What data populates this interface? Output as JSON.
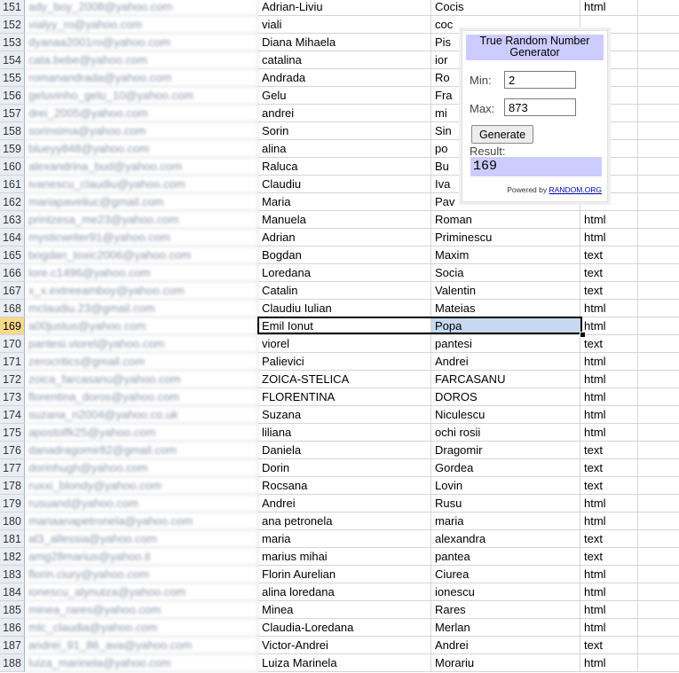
{
  "spreadsheet": {
    "active_row": "169",
    "rows": [
      {
        "num": "151",
        "email": "ady_boy_2008@yahoo.com",
        "first": "Adrian-Liviu",
        "last": "Cocis",
        "type": "html"
      },
      {
        "num": "152",
        "email": "vialyy_ro@yahoo.com",
        "first": "viali",
        "last": "coc",
        "type": ""
      },
      {
        "num": "153",
        "email": "dyanaa2001ro@yahoo.com",
        "first": "Diana Mihaela",
        "last": "Pis",
        "type": ""
      },
      {
        "num": "154",
        "email": "cata.bebe@yahoo.com",
        "first": "catalina",
        "last": "ior",
        "type": ""
      },
      {
        "num": "155",
        "email": "romanandrada@yahoo.com",
        "first": "Andrada",
        "last": "Ro",
        "type": ""
      },
      {
        "num": "156",
        "email": "geluvinho_gelu_10@yahoo.com",
        "first": "Gelu",
        "last": "Fra",
        "type": ""
      },
      {
        "num": "157",
        "email": "drei_2005@yahoo.com",
        "first": "andrei",
        "last": "mi",
        "type": ""
      },
      {
        "num": "158",
        "email": "sorinsima@yahoo.com",
        "first": "Sorin",
        "last": "Sin",
        "type": ""
      },
      {
        "num": "159",
        "email": "blueyy848@yahoo.com",
        "first": "alina",
        "last": "po",
        "type": ""
      },
      {
        "num": "160",
        "email": "alexandrina_bud@yahoo.com",
        "first": "Raluca",
        "last": "Bu",
        "type": ""
      },
      {
        "num": "161",
        "email": "ivanescu_claudiu@yahoo.com",
        "first": "Claudiu",
        "last": "Iva",
        "type": ""
      },
      {
        "num": "162",
        "email": "mariapaveliuc@gmail.com",
        "first": "Maria",
        "last": "Pav",
        "type": ""
      },
      {
        "num": "163",
        "email": "printzesa_me23@yahoo.com",
        "first": "Manuela",
        "last": "Roman",
        "type": "html"
      },
      {
        "num": "164",
        "email": "mysticwriter91@yahoo.com",
        "first": "Adrian",
        "last": "Priminescu",
        "type": "html"
      },
      {
        "num": "165",
        "email": "bogdan_toxic2006@yahoo.com",
        "first": "Bogdan",
        "last": "Maxim",
        "type": "text"
      },
      {
        "num": "166",
        "email": "lore.c1496@yahoo.com",
        "first": "Loredana",
        "last": "Socia",
        "type": "text"
      },
      {
        "num": "167",
        "email": "x_x.extreeamboy@yahoo.com",
        "first": "Catalin",
        "last": "Valentin",
        "type": "text"
      },
      {
        "num": "168",
        "email": "mclaudiu.23@gmail.com",
        "first": "Claudiu Iulian",
        "last": "Mateias",
        "type": "html"
      },
      {
        "num": "169",
        "email": "a00justus@yahoo.com",
        "first": "Emil Ionut",
        "last": "Popa",
        "type": "html"
      },
      {
        "num": "170",
        "email": "pantesi.viorel@yahoo.com",
        "first": "viorel",
        "last": "pantesi",
        "type": "text"
      },
      {
        "num": "171",
        "email": "zerocritics@gmail.com",
        "first": "Palievici",
        "last": "Andrei",
        "type": "html"
      },
      {
        "num": "172",
        "email": "zoica_farcasanu@yahoo.com",
        "first": "ZOICA-STELICA",
        "last": "FARCASANU",
        "type": "html"
      },
      {
        "num": "173",
        "email": "florentina_doros@yahoo.com",
        "first": "FLORENTINA",
        "last": "DOROS",
        "type": "html"
      },
      {
        "num": "174",
        "email": "suzana_n2004@yahoo.co.uk",
        "first": "Suzana",
        "last": "Niculescu",
        "type": "html"
      },
      {
        "num": "175",
        "email": "apostolfk25@yahoo.com",
        "first": "liliana",
        "last": "ochi rosii",
        "type": "html"
      },
      {
        "num": "176",
        "email": "danadragomir82@gmail.com",
        "first": "Daniela",
        "last": "Dragomir",
        "type": "text"
      },
      {
        "num": "177",
        "email": "dorinhugh@yahoo.com",
        "first": "Dorin",
        "last": "Gordea",
        "type": "text"
      },
      {
        "num": "178",
        "email": "ruxxi_blondy@yahoo.com",
        "first": "Rocsana",
        "last": "Lovin",
        "type": "text"
      },
      {
        "num": "179",
        "email": "rusuand@yahoo.com",
        "first": "Andrei",
        "last": "Rusu",
        "type": "html"
      },
      {
        "num": "180",
        "email": "mariaanapetronela@yahoo.com",
        "first": "ana petronela",
        "last": "maria",
        "type": "html"
      },
      {
        "num": "181",
        "email": "al3_allessia@yahoo.com",
        "first": "maria",
        "last": "alexandra",
        "type": "text"
      },
      {
        "num": "182",
        "email": "amg28marius@yahoo.it",
        "first": "marius mihai",
        "last": "pantea",
        "type": "text"
      },
      {
        "num": "183",
        "email": "florin.ciury@yahoo.com",
        "first": "Florin Aurelian",
        "last": "Ciurea",
        "type": "html"
      },
      {
        "num": "184",
        "email": "ionescu_alynutza@yahoo.com",
        "first": "alina loredana",
        "last": "ionescu",
        "type": "html"
      },
      {
        "num": "185",
        "email": "minea_rares@yahoo.com",
        "first": "Minea",
        "last": "Rares",
        "type": "html"
      },
      {
        "num": "186",
        "email": "mlc_claudia@yahoo.com",
        "first": "Claudia-Loredana",
        "last": "Merlan",
        "type": "html"
      },
      {
        "num": "187",
        "email": "andrei_91_86_ava@yahoo.com",
        "first": "Victor-Andrei",
        "last": "Andrei",
        "type": "text"
      },
      {
        "num": "188",
        "email": "luiza_marinela@yahoo.com",
        "first": "Luiza Marinela",
        "last": "Morariu",
        "type": "html"
      }
    ]
  },
  "widget": {
    "title": "True Random Number Generator",
    "min_label": "Min:",
    "min_value": "2",
    "max_label": "Max:",
    "max_value": "873",
    "button_label": "Generate",
    "result_label": "Result:",
    "result_value": "169",
    "powered_by": "Powered by",
    "powered_link": "RANDOM.ORG",
    "title_bg": "#ccccff"
  }
}
